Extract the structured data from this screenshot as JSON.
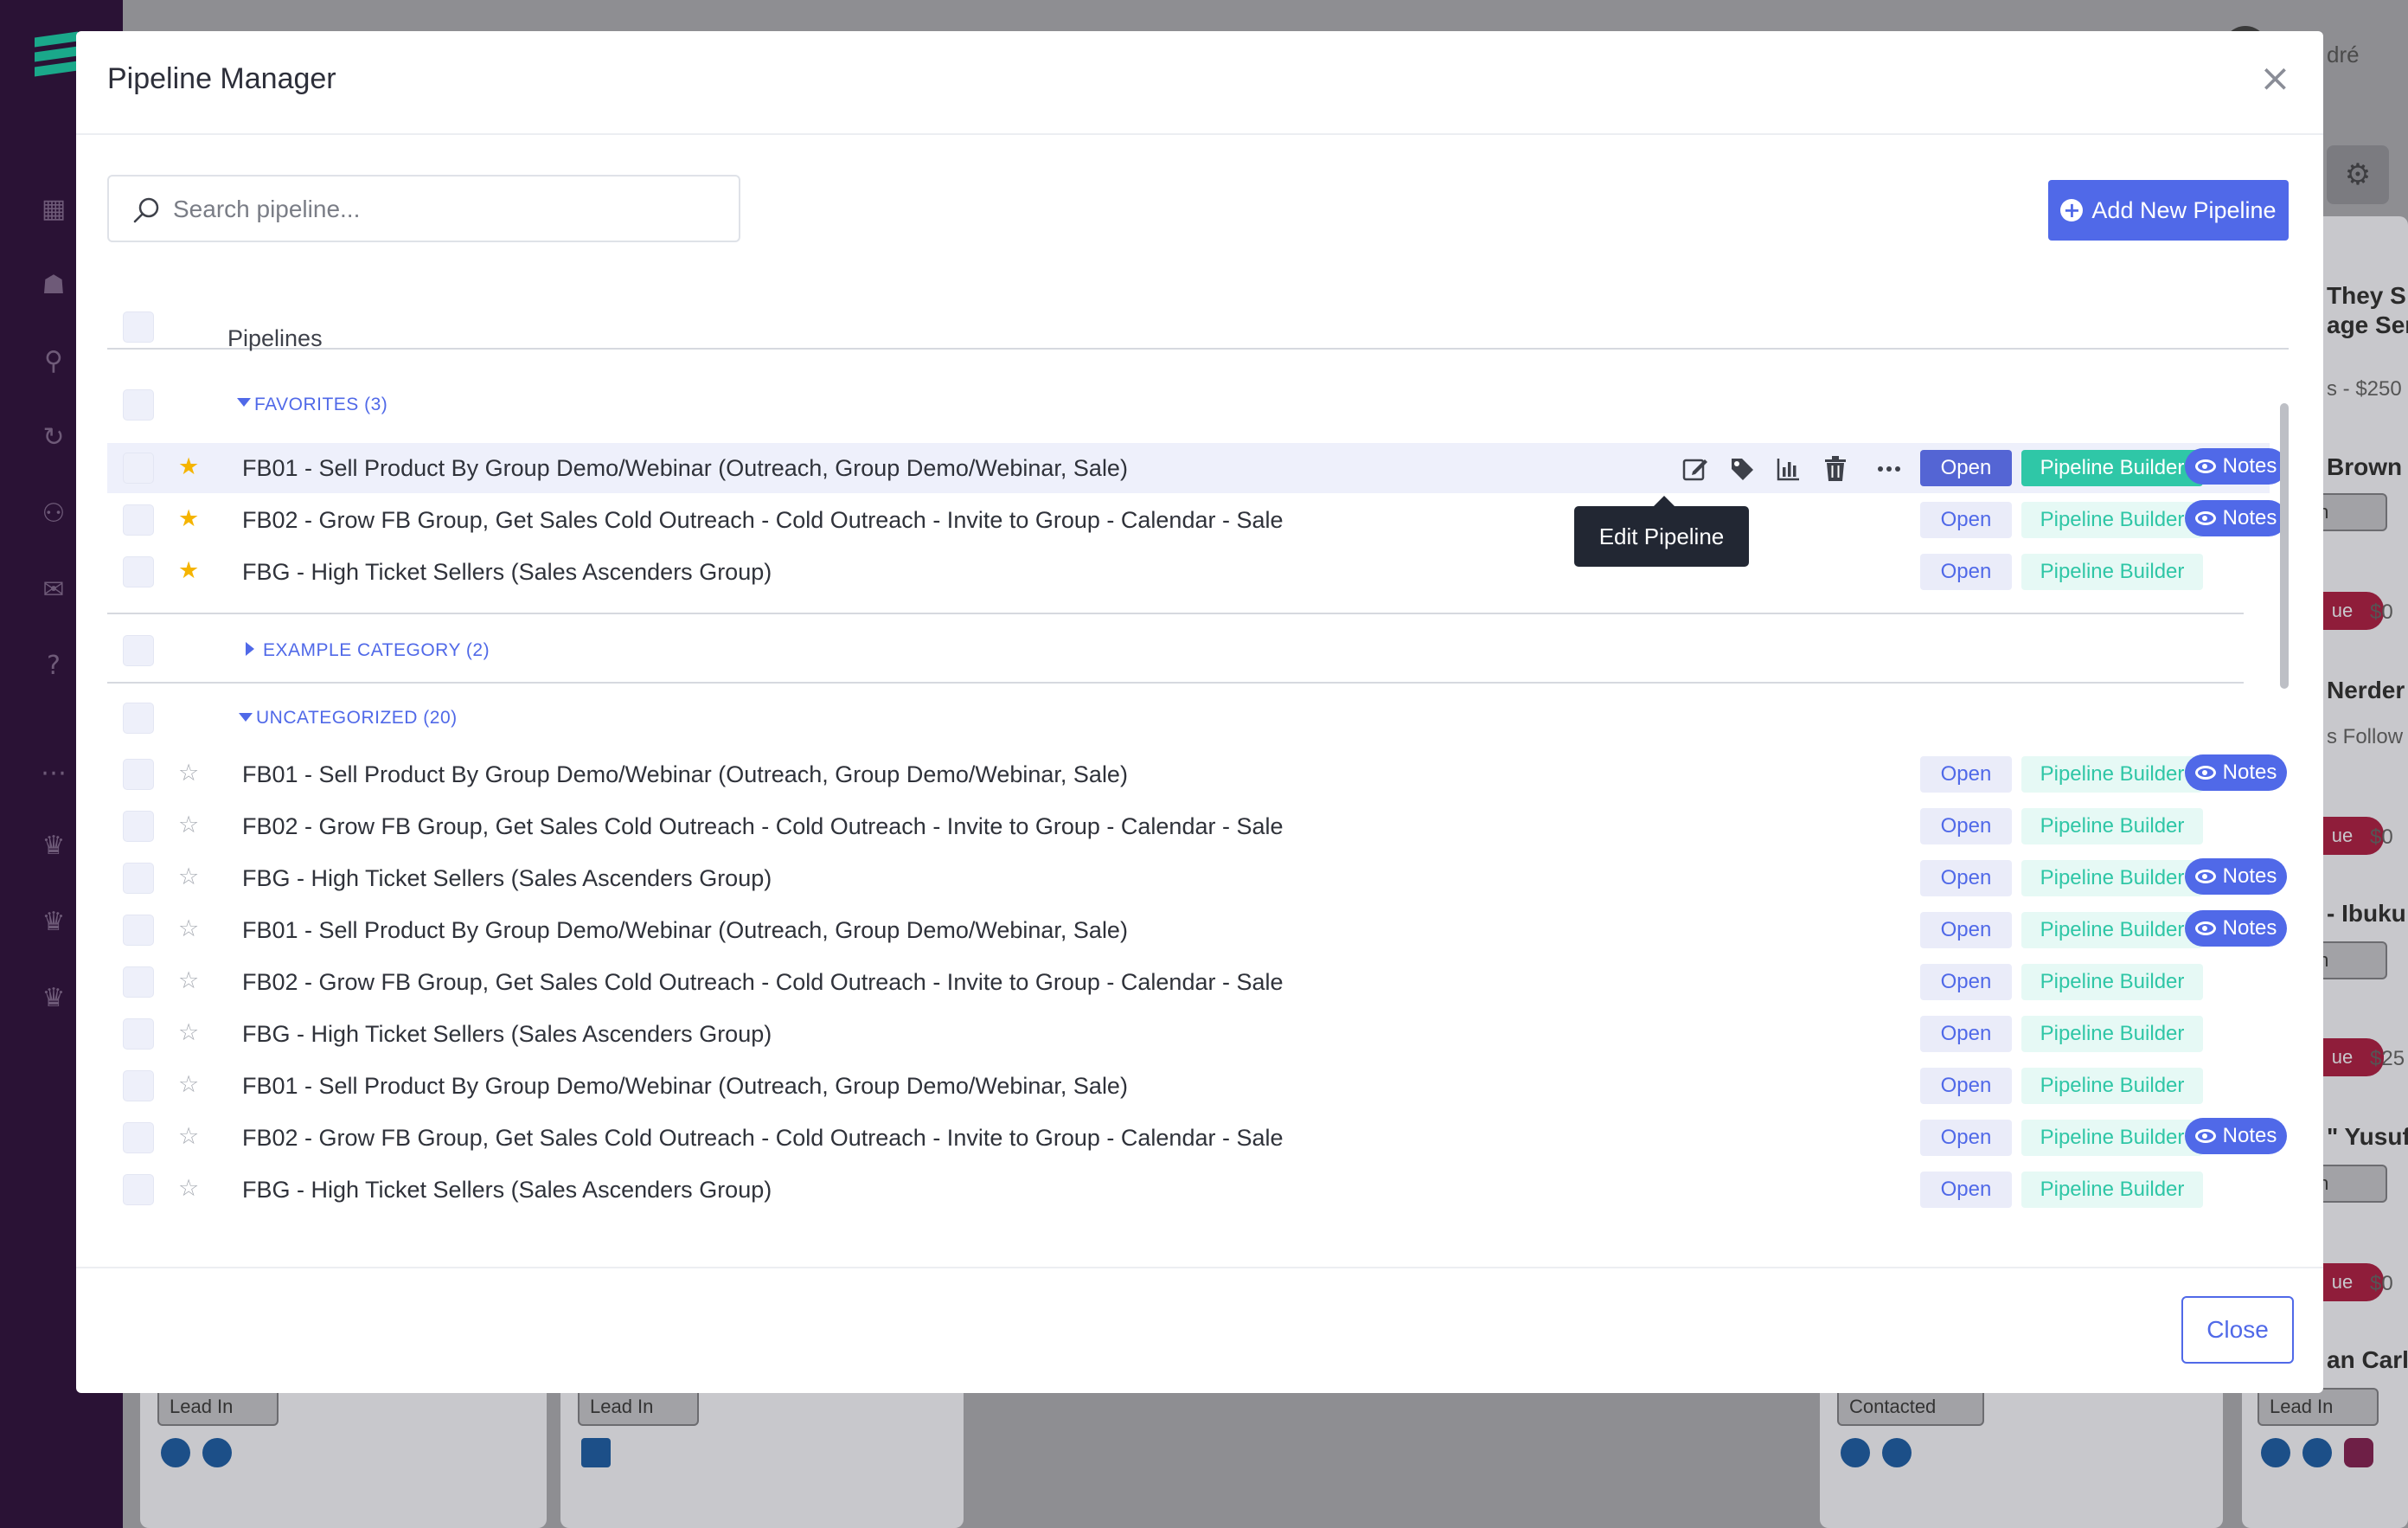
{
  "background": {
    "username": "dré",
    "col_texts": [
      "They S",
      "age Sen",
      "s - $250",
      "Brown",
      "Nerder",
      "s Follow",
      "- Ibuku",
      "\" Yusuf",
      "an Carls"
    ],
    "values": [
      "$0",
      "$0",
      "$25",
      "$0"
    ],
    "pill_text": "ue",
    "select_lead_in": "Lead In",
    "select_in": "In",
    "select_contacted": "Contacted"
  },
  "modal": {
    "title": "Pipeline Manager",
    "search_placeholder": "Search pipeline...",
    "add_button": "Add New Pipeline",
    "header_label": "Pipelines",
    "tooltip": "Edit Pipeline",
    "close_button": "Close"
  },
  "categories": [
    {
      "label": "FAVORITES (3)",
      "expanded": true
    },
    {
      "label": "EXAMPLE CATEGORY (2)",
      "expanded": false
    },
    {
      "label": "UNCATEGORIZED (20)",
      "expanded": true
    }
  ],
  "buttons": {
    "open": "Open",
    "builder": "Pipeline Builder",
    "notes": "Notes"
  },
  "favorites": [
    {
      "title": "FB01 - Sell Product By Group Demo/Webinar (Outreach, Group Demo/Webinar, Sale)",
      "starred": true,
      "notes": true,
      "highlighted": true
    },
    {
      "title": "FB02 - Grow FB Group, Get Sales Cold Outreach - Cold Outreach - Invite to Group - Calendar - Sale",
      "starred": true,
      "notes": true,
      "highlighted": false
    },
    {
      "title": "FBG - High Ticket Sellers (Sales Ascenders Group)",
      "starred": true,
      "notes": false,
      "highlighted": false
    }
  ],
  "uncategorized": [
    {
      "title": "FB01 - Sell Product By Group Demo/Webinar (Outreach, Group Demo/Webinar, Sale)",
      "starred": false,
      "notes": true
    },
    {
      "title": "FB02 - Grow FB Group, Get Sales Cold Outreach - Cold Outreach - Invite to Group - Calendar - Sale",
      "starred": false,
      "notes": false
    },
    {
      "title": "FBG - High Ticket Sellers (Sales Ascenders Group)",
      "starred": false,
      "notes": true
    },
    {
      "title": "FB01 - Sell Product By Group Demo/Webinar (Outreach, Group Demo/Webinar, Sale)",
      "starred": false,
      "notes": true
    },
    {
      "title": "FB02 - Grow FB Group, Get Sales Cold Outreach - Cold Outreach - Invite to Group - Calendar - Sale",
      "starred": false,
      "notes": false
    },
    {
      "title": "FBG - High Ticket Sellers (Sales Ascenders Group)",
      "starred": false,
      "notes": false
    },
    {
      "title": "FB01 - Sell Product By Group Demo/Webinar (Outreach, Group Demo/Webinar, Sale)",
      "starred": false,
      "notes": false
    },
    {
      "title": "FB02 - Grow FB Group, Get Sales Cold Outreach - Cold Outreach - Invite to Group - Calendar - Sale",
      "starred": false,
      "notes": true
    },
    {
      "title": "FBG - High Ticket Sellers (Sales Ascenders Group)",
      "starred": false,
      "notes": false
    }
  ],
  "colors": {
    "primary": "#5069e8",
    "teal": "#2fc7a7",
    "star": "#f5b400",
    "sidebar": "#2a1235"
  }
}
